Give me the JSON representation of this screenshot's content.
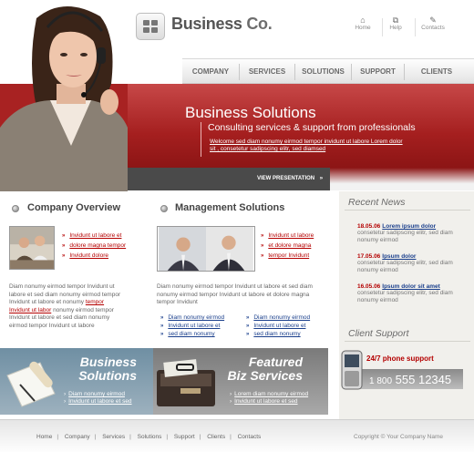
{
  "header": {
    "logo_text_1": "Business",
    "logo_text_2": "Co.",
    "top_links": [
      {
        "label": "Home",
        "icon": "home-icon"
      },
      {
        "label": "Help",
        "icon": "help-icon"
      },
      {
        "label": "Contacts",
        "icon": "contacts-icon"
      }
    ]
  },
  "nav": {
    "items": [
      "COMPANY",
      "SERVICES",
      "SOLUTIONS",
      "SUPPORT",
      "CLIENTS"
    ]
  },
  "banner": {
    "title": "Business Solutions",
    "subtitle": "Consulting services & support from professionals",
    "welcome": "Welcome sed diam nonumy eirmod tempor invidunt ut labore Lorem dolor sit , consetetur sadipscing elitr, sed diamsed",
    "presentation_label": "VIEW PRESENTATION",
    "presentation_arrow": "»"
  },
  "company_overview": {
    "title": "Company Overview",
    "links": [
      "Invidunt ut labore et",
      "dolore magna tempor",
      "Invidunt dolore"
    ],
    "para_before": "Diam nonumy eirmod tempor Invidunt ut labore et  sed diam nonumy eirmod tempor Invidunt ut labore et nonumy ",
    "para_highlight": "tempor Invidunt ut labor",
    "para_after": " nonumy eirmod tempor Invidunt ut labore et  sed diam nonumy eirmod tempor Invidunt ut labore"
  },
  "management_solutions": {
    "title": "Management Solutions",
    "links": [
      "Invidunt ut labore",
      "et dolore magna",
      "tempor Invidunt"
    ],
    "para": "Diam nonumy eirmod tempor Invidunt ut labore et  sed diam nonumy eirmod tempor Invidunt ut labore et dolore magna tempor Invidunt",
    "links_col1": [
      "Diam nonumy eirmod",
      "Invidunt ut labore et",
      "sed diam nonumy"
    ],
    "links_col2": [
      "Diam nonumy eirmod",
      "Invidunt ut labore et",
      "sed diam nonumy"
    ]
  },
  "business_box": {
    "title_1": "Business",
    "title_2": "Solutions",
    "links": [
      "Diam nonumy eirmod",
      "Invidunt ut labore et  sed"
    ]
  },
  "featured_box": {
    "title_1": "Featured",
    "title_2": "Biz Services",
    "links": [
      "Lorem diam nonumy eirmod",
      "Invidunt ut labore et  sed"
    ]
  },
  "recent_news": {
    "title": "Recent News",
    "items": [
      {
        "date": "18.05.06",
        "headline": "Lorem ipsum dolor",
        "body": "consetetur sadipscing elitr, sed diam nonumy eirmod"
      },
      {
        "date": "17.05.06",
        "headline": "Ipsum dolor",
        "body": "consetetur sadipscing elitr, sed diam nonumy eirmod"
      },
      {
        "date": "16.05.06",
        "headline": "Ipsum dolor sit amet",
        "body": "consetetur sadipscing elitr, sed diam nonumy eirmod"
      }
    ]
  },
  "client_support": {
    "title": "Client Support",
    "label": "24/7 phone support",
    "number_prefix": "1 800",
    "number": "555 12345"
  },
  "footer": {
    "links": [
      "Home",
      "Company",
      "Services",
      "Solutions",
      "Support",
      "Clients",
      "Contacts"
    ],
    "copyright": "Copyright © Your Company Name"
  },
  "colors": {
    "accent_red": "#a51f1f",
    "link_red": "#b40000",
    "link_blue": "#1a3f8c"
  }
}
